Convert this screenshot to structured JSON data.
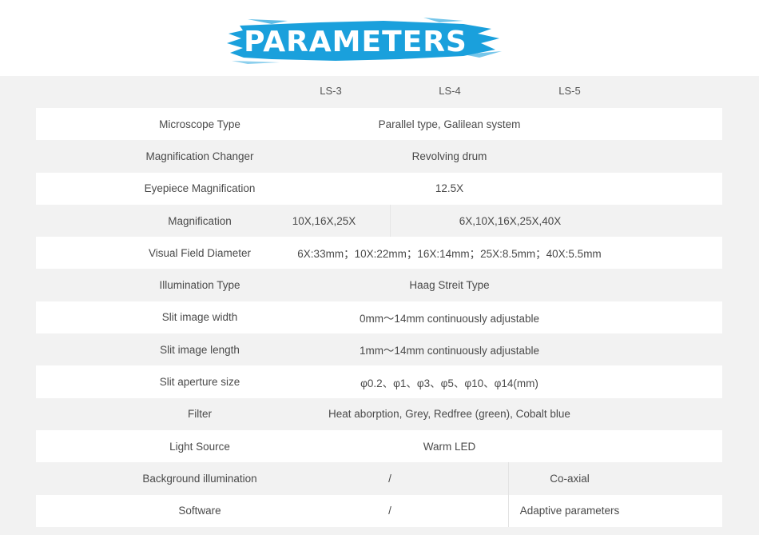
{
  "title": "PARAMETERS",
  "colors": {
    "brush": "#1aa0dc",
    "title_text": "#ffffff"
  },
  "columns": [
    "LS-3",
    "LS-4",
    "LS-5"
  ],
  "rows": [
    {
      "label": "Microscope Type",
      "value": "Parallel type, Galilean system"
    },
    {
      "label": "Magnification Changer",
      "value": "Revolving drum"
    },
    {
      "label": "Eyepiece Magnification",
      "value": "12.5X"
    },
    {
      "label": "Magnification",
      "ls3": "10X,16X,25X",
      "ls45": "6X,10X,16X,25X,40X"
    },
    {
      "label": "Visual Field Diameter",
      "value": "6X:33mm；10X:22mm；16X:14mm；25X:8.5mm；40X:5.5mm"
    },
    {
      "label": "Illumination Type",
      "value": "Haag Streit Type"
    },
    {
      "label": "Slit image width",
      "value": "0mm～14mm continuously adjustable"
    },
    {
      "label": "Slit image length",
      "value": "1mm～14mm continuously adjustable"
    },
    {
      "label": "Slit aperture size",
      "value": "φ0.2、φ1、φ3、φ5、φ10、φ14(mm)"
    },
    {
      "label": "Filter",
      "value": "Heat aborption, Grey, Redfree (green), Cobalt blue"
    },
    {
      "label": "Light Source",
      "value": "Warm LED"
    },
    {
      "label": "Background illumination",
      "ls34": "/",
      "ls5": "Co-axial"
    },
    {
      "label": "Software",
      "ls34": "/",
      "ls5": "Adaptive parameters"
    }
  ]
}
